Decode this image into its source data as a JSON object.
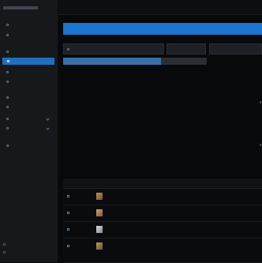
{
  "sidebar": {
    "title": "",
    "sections": [
      {
        "label": ""
      },
      {
        "label": ""
      },
      {
        "label": ""
      }
    ],
    "items": [
      {
        "label": "",
        "icon": "file-icon",
        "active": false
      },
      {
        "label": "",
        "icon": "folder-icon",
        "active": false
      },
      {
        "label": "",
        "icon": "list-icon",
        "active": false
      },
      {
        "label": "",
        "icon": "image-icon",
        "active": true
      },
      {
        "label": "",
        "icon": "grid-icon",
        "active": false
      },
      {
        "label": "",
        "icon": "doc-icon",
        "active": false
      },
      {
        "label": "",
        "icon": "settings-icon",
        "active": false
      },
      {
        "label": "",
        "icon": "tag-icon",
        "active": false
      },
      {
        "label": "",
        "icon": "box-icon",
        "active": false
      },
      {
        "label": "",
        "icon": "user-icon",
        "active": false
      },
      {
        "label": "",
        "icon": "folder-icon",
        "active": false
      }
    ],
    "footer": [
      {
        "label": ""
      },
      {
        "label": ""
      }
    ]
  },
  "topbar": {
    "breadcrumb": ""
  },
  "header": {
    "title": ""
  },
  "filters": {
    "search_label": "",
    "search_placeholder": "",
    "type_label": "",
    "type_value": "",
    "extra_value": ""
  },
  "progress": {
    "text": "",
    "fraction": 0.68
  },
  "table": {
    "columns": [
      "",
      "",
      "",
      "",
      ""
    ],
    "rows": [
      {
        "id": "",
        "name": "",
        "size": "",
        "path": ""
      },
      {
        "id": "",
        "name": "",
        "size": "",
        "path": ""
      },
      {
        "id": "",
        "name": "",
        "size": "",
        "path": ""
      },
      {
        "id": "",
        "name": "",
        "size": "",
        "path": ""
      }
    ]
  },
  "colors": {
    "accent": "#1b74cd",
    "sidebar_bg": "#16181c",
    "page_bg": "#08090b",
    "active_item": "#1f6fbf"
  }
}
